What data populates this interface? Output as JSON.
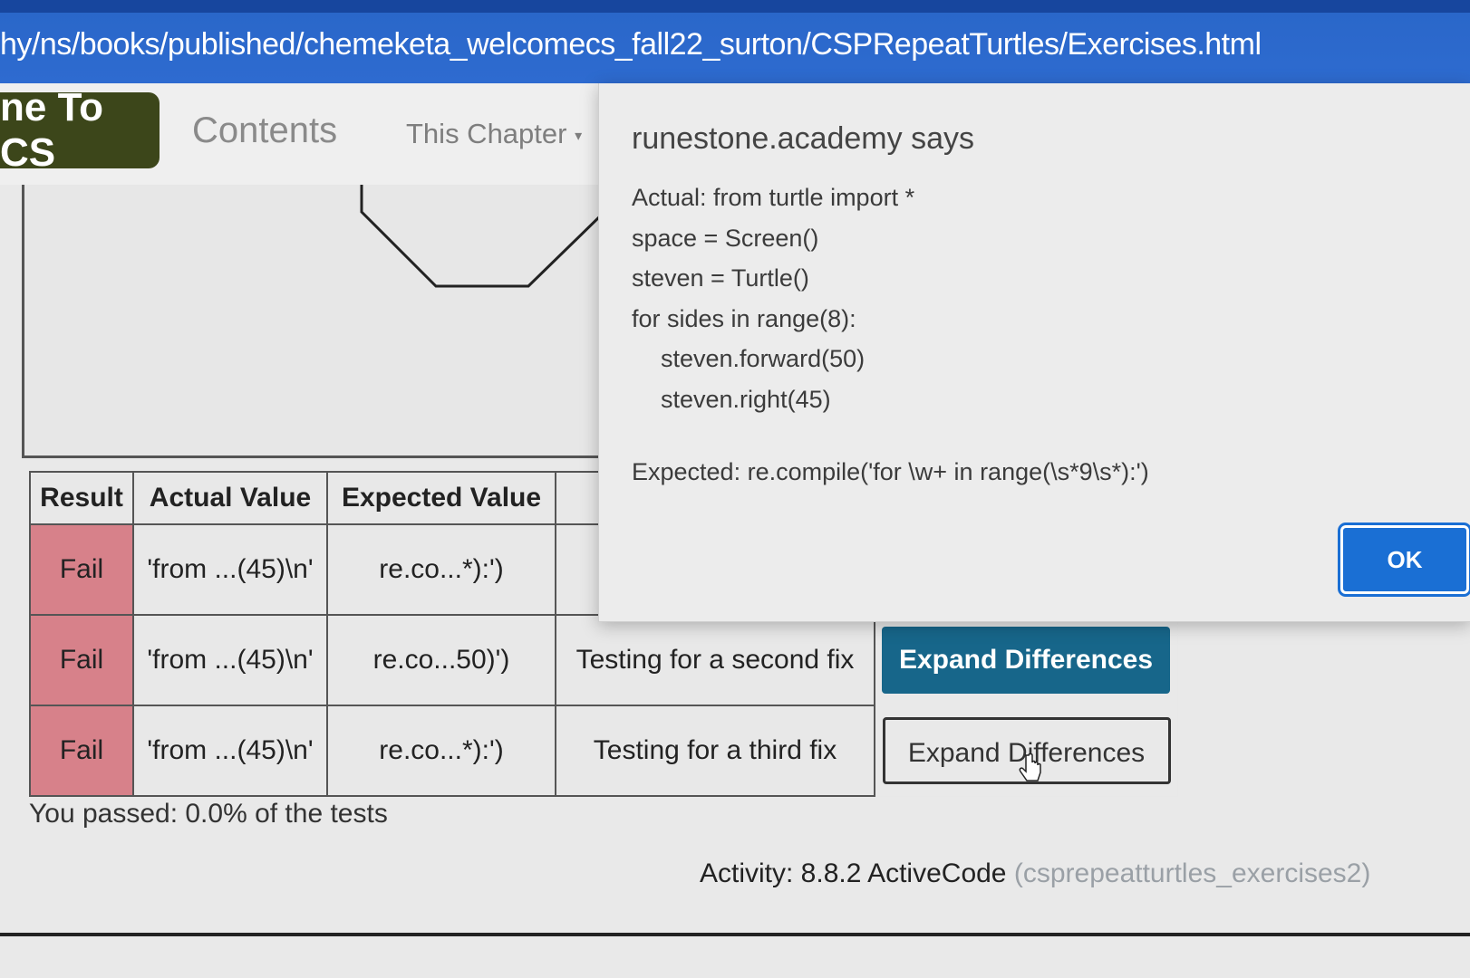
{
  "browser": {
    "url": "hy/ns/books/published/chemeketa_welcomecs_fall22_surton/CSPRepeatTurtles/Exercises.html"
  },
  "navbar": {
    "brand": "ne To CS",
    "contents": "Contents",
    "this_chapter": "This Chapter",
    "caret": "▾"
  },
  "results": {
    "headers": [
      "Result",
      "Actual Value",
      "Expected Value"
    ],
    "rows": [
      {
        "result": "Fail",
        "actual": "'from ...(45)\\n'",
        "expected": "re.co...*):')",
        "message": "",
        "button": ""
      },
      {
        "result": "Fail",
        "actual": "'from ...(45)\\n'",
        "expected": "re.co...50)')",
        "message": "Testing for a second fix",
        "button": "Expand Differences"
      },
      {
        "result": "Fail",
        "actual": "'from ...(45)\\n'",
        "expected": "re.co...*):')",
        "message": "Testing for a third fix",
        "button": "Expand Differences"
      }
    ],
    "passed": "You passed: 0.0% of the tests"
  },
  "activity": {
    "label": "Activity: 8.8.2 ActiveCode",
    "id": "(csprepeatturtles_exercises2)"
  },
  "dialog": {
    "title": "runestone.academy says",
    "lines": [
      "Actual: from turtle import *",
      "space = Screen()",
      "steven = Turtle()",
      "for sides in range(8):",
      "steven.forward(50)",
      "steven.right(45)"
    ],
    "expected": "Expected: re.compile('for \\w+ in range(\\s*9\\s*):')",
    "ok": "OK"
  },
  "colors": {
    "fail": "#d7818a",
    "expand_button": "#17668a",
    "ok_button": "#1a6fd4",
    "brand": "#3c461a"
  }
}
